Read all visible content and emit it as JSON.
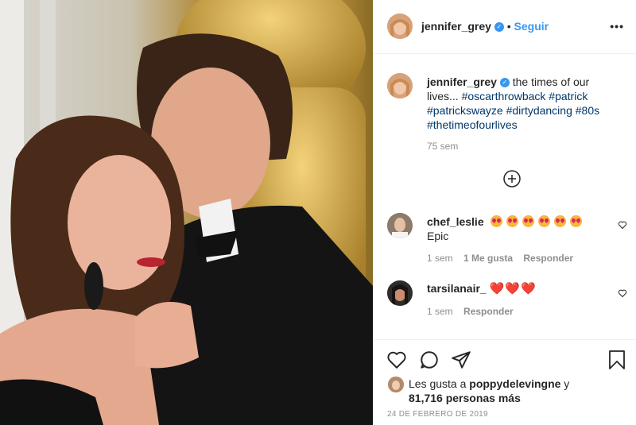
{
  "post": {
    "author": "jennifer_grey",
    "follow_label": "Seguir",
    "more_label": "•••",
    "caption_text": "the times of our lives...",
    "hashtags": [
      "#oscarthrowback",
      "#patrick",
      "#patrickswayze",
      "#dirtydancing",
      "#80s",
      "#thetimeofourlives"
    ],
    "caption_age": "75 sem"
  },
  "comments": [
    {
      "user": "chef_leslie",
      "text": "Epic",
      "emoji_count": 6,
      "age": "1 sem",
      "likes": "1 Me gusta",
      "reply": "Responder"
    },
    {
      "user": "tarsilanair_",
      "text": "",
      "hearts": "❤️❤️❤️",
      "age": "1 sem",
      "reply": "Responder"
    }
  ],
  "likes_line": {
    "prefix": "Les gusta a",
    "user": "poppydelevingne",
    "conj": "y",
    "count": "81,716",
    "suffix": "personas más"
  },
  "date": "24 DE FEBRERO DE 2019",
  "colors": {
    "accent": "#3897f0",
    "hashtag": "#00376b",
    "muted": "#8e8e8e"
  },
  "icons": [
    "verified-icon",
    "more-icon",
    "plus-circle-icon",
    "heart-icon",
    "comment-icon",
    "share-icon",
    "bookmark-icon"
  ]
}
